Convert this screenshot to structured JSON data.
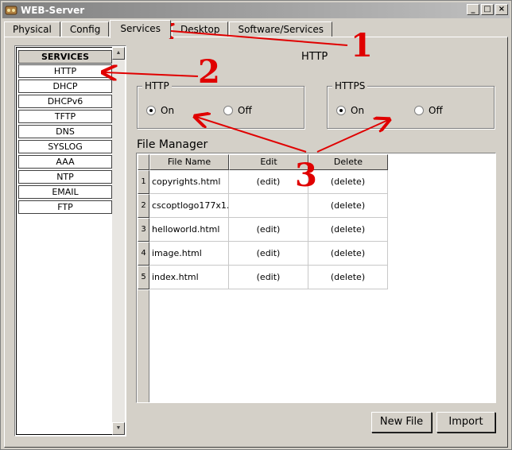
{
  "window": {
    "title": "WEB-Server"
  },
  "titlebar_buttons": [
    "_",
    "□",
    "×"
  ],
  "tabs": [
    {
      "label": "Physical"
    },
    {
      "label": "Config"
    },
    {
      "label": "Services",
      "active": true
    },
    {
      "label": "Desktop"
    },
    {
      "label": "Software/Services"
    }
  ],
  "services": {
    "header": "SERVICES",
    "items": [
      "HTTP",
      "DHCP",
      "DHCPv6",
      "TFTP",
      "DNS",
      "SYSLOG",
      "AAA",
      "NTP",
      "EMAIL",
      "FTP"
    ],
    "selected": "HTTP"
  },
  "section_title": "HTTP",
  "http_group": {
    "label": "HTTP",
    "on_label": "On",
    "off_label": "Off",
    "selected": "On"
  },
  "https_group": {
    "label": "HTTPS",
    "on_label": "On",
    "off_label": "Off",
    "selected": "On"
  },
  "file_manager": {
    "label": "File Manager",
    "columns": [
      "File Name",
      "Edit",
      "Delete"
    ],
    "rows": [
      {
        "num": "1",
        "name": "copyrights.html",
        "edit": "(edit)",
        "delete": "(delete)"
      },
      {
        "num": "2",
        "name": "cscoptlogo177x1...",
        "edit": "",
        "delete": "(delete)"
      },
      {
        "num": "3",
        "name": "helloworld.html",
        "edit": "(edit)",
        "delete": "(delete)"
      },
      {
        "num": "4",
        "name": "image.html",
        "edit": "(edit)",
        "delete": "(delete)"
      },
      {
        "num": "5",
        "name": "index.html",
        "edit": "(edit)",
        "delete": "(delete)"
      }
    ]
  },
  "buttons": {
    "new_file": "New File",
    "import": "Import"
  },
  "annotations": {
    "n1": "1",
    "n2": "2",
    "n3": "3"
  },
  "colors": {
    "annotation": "#e00000",
    "chrome": "#d4d0c8",
    "titlebar": "#808080"
  }
}
